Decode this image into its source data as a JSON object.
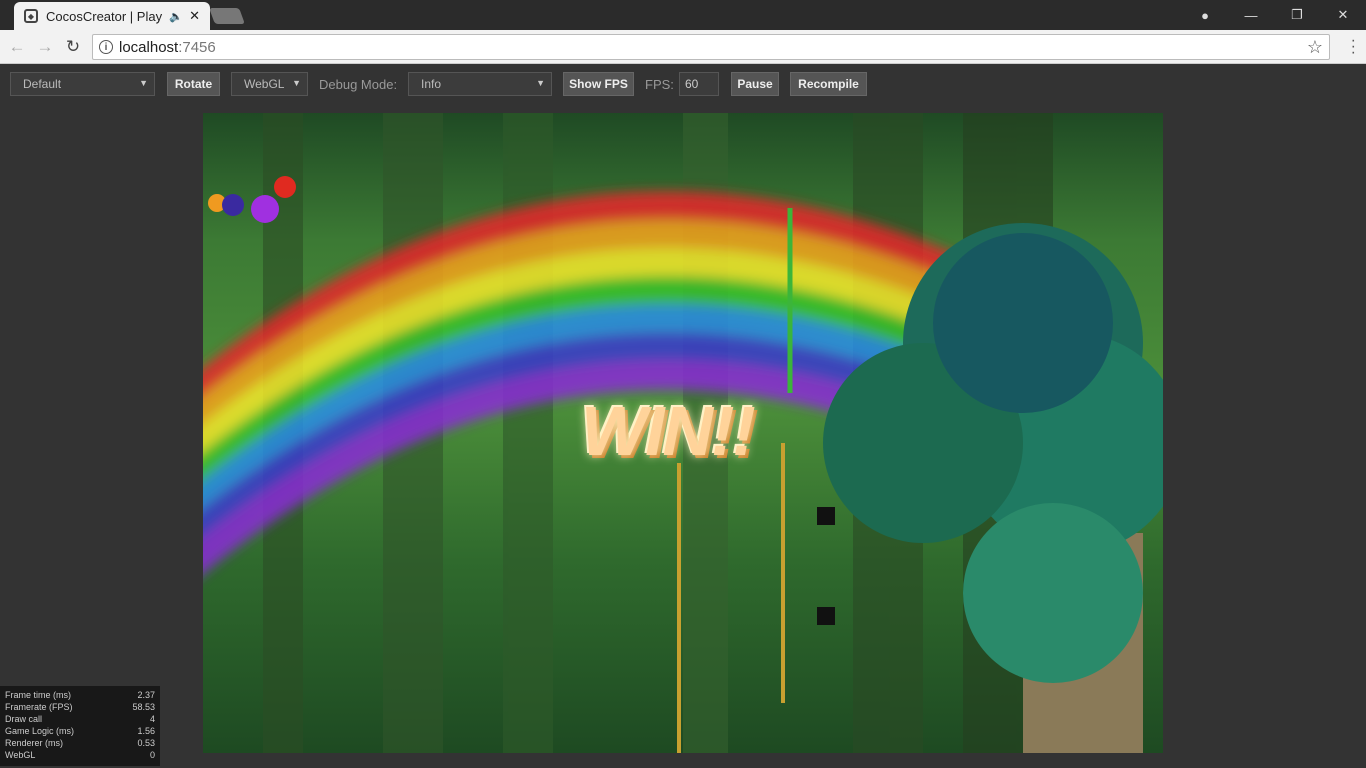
{
  "browser": {
    "tab_title": "CocosCreator | Play",
    "audio_icon": "speaker-icon",
    "url_host": "localhost",
    "url_port": ":7456"
  },
  "toolbar": {
    "device_select": "Default",
    "rotate_label": "Rotate",
    "renderer_select": "WebGL",
    "debug_mode_label": "Debug Mode:",
    "debug_mode_select": "Info",
    "show_fps_label": "Show FPS",
    "fps_label": "FPS:",
    "fps_value": "60",
    "pause_label": "Pause",
    "recompile_label": "Recompile"
  },
  "game": {
    "win_text": "WIN!!"
  },
  "stats": [
    {
      "label": "Frame time (ms)",
      "value": "2.37"
    },
    {
      "label": "Framerate (FPS)",
      "value": "58.53"
    },
    {
      "label": "Draw call",
      "value": "4"
    },
    {
      "label": "Game Logic (ms)",
      "value": "1.56"
    },
    {
      "label": "Renderer (ms)",
      "value": "0.53"
    },
    {
      "label": "WebGL",
      "value": "0"
    }
  ],
  "colors": {
    "toolbar_bg": "#333333",
    "button_bg": "#555555",
    "win_text": "#ffd39a"
  }
}
